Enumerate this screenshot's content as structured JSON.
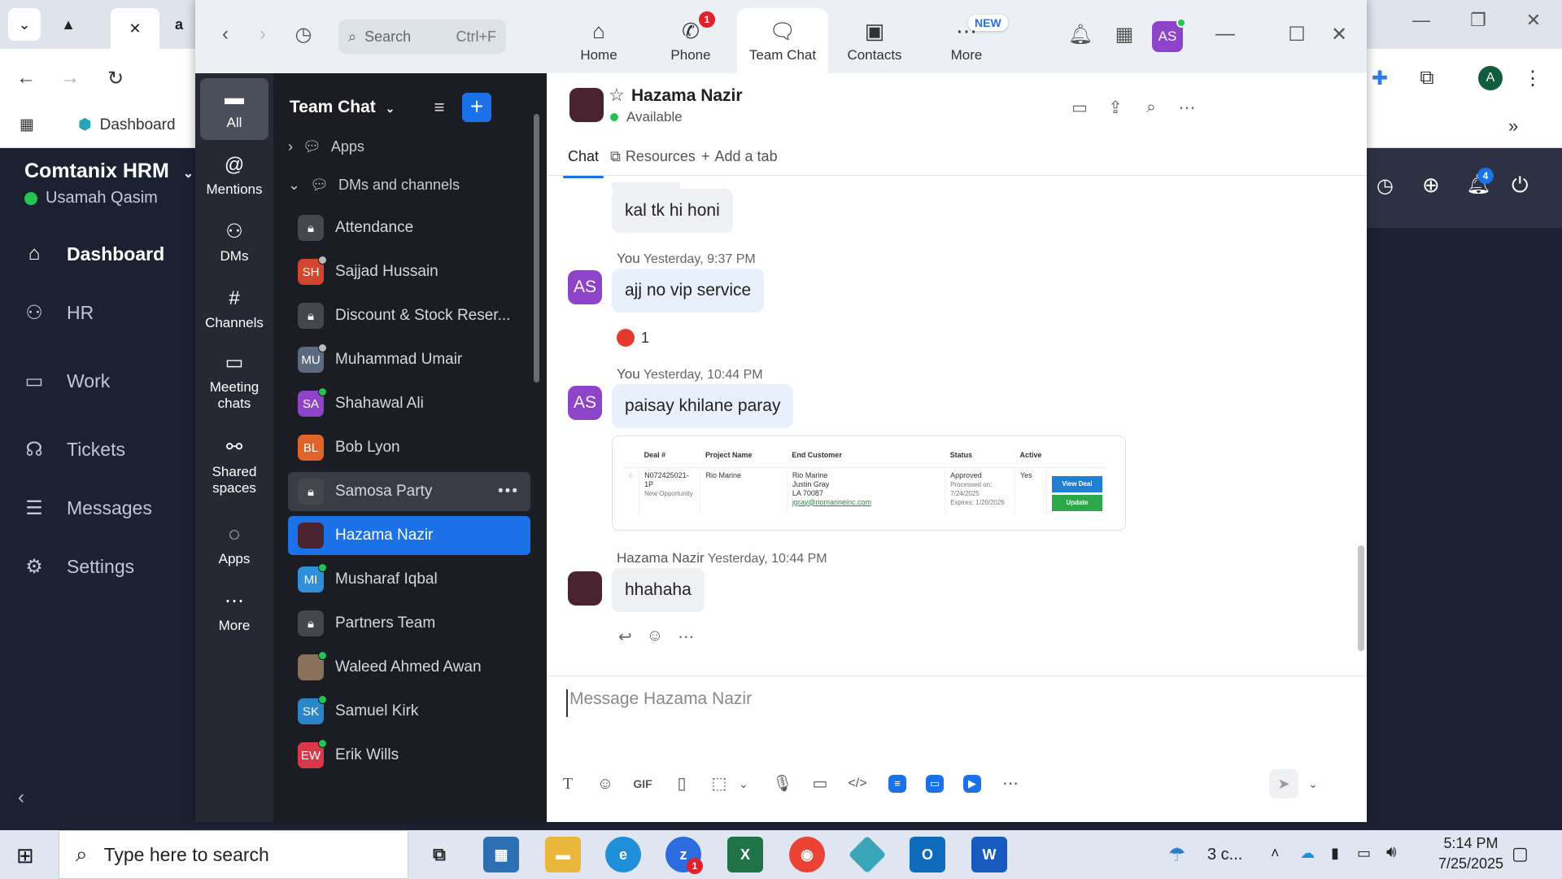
{
  "browser": {
    "bookmarks": [
      {
        "label": "Dashboard"
      }
    ]
  },
  "hrm": {
    "brand": "Comtanix HRM",
    "user": "Usamah Qasim",
    "nav": [
      {
        "label": "Dashboard",
        "icon": "home-icon"
      },
      {
        "label": "HR",
        "icon": "people-icon"
      },
      {
        "label": "Work",
        "icon": "briefcase-icon"
      },
      {
        "label": "Tickets",
        "icon": "headset-icon"
      },
      {
        "label": "Messages",
        "icon": "chat-icon"
      },
      {
        "label": "Settings",
        "icon": "gear-icon"
      }
    ],
    "notif_count": "4"
  },
  "zoom": {
    "search": {
      "label": "Search",
      "shortcut": "Ctrl+F"
    },
    "tabs": [
      {
        "label": "Home",
        "icon": "home-icon"
      },
      {
        "label": "Phone",
        "icon": "phone-icon",
        "badge": "1"
      },
      {
        "label": "Team Chat",
        "icon": "chat-icon",
        "active": true
      },
      {
        "label": "Contacts",
        "icon": "contacts-icon"
      },
      {
        "label": "More",
        "icon": "more-icon",
        "badge": "NEW"
      }
    ],
    "user_avatar": "AS",
    "rail": [
      {
        "label": "All"
      },
      {
        "label": "Mentions"
      },
      {
        "label": "DMs"
      },
      {
        "label": "Channels"
      },
      {
        "label": "Meeting chats"
      },
      {
        "label": "Shared spaces"
      },
      {
        "label": "Apps"
      },
      {
        "label": "More"
      }
    ],
    "list": {
      "title": "Team Chat",
      "apps_section": "Apps",
      "dms_section": "DMs and channels",
      "items": [
        {
          "name": "Attendance",
          "type": "lock"
        },
        {
          "name": "Sajjad Hussain",
          "initials": "SH",
          "color": "#d2452f",
          "status": "away"
        },
        {
          "name": "Discount & Stock Reser...",
          "type": "lock"
        },
        {
          "name": "Muhammad Umair",
          "initials": "MU",
          "color": "#5b6a7e",
          "status": "away"
        },
        {
          "name": "Shahawal Ali",
          "initials": "SA",
          "color": "#8e44c9",
          "status": "online"
        },
        {
          "name": "Bob Lyon",
          "initials": "BL",
          "color": "#e0632a",
          "status": ""
        },
        {
          "name": "Samosa Party",
          "type": "lock",
          "hover": true
        },
        {
          "name": "Hazama Nazir",
          "initials": "",
          "color": "#4a2330",
          "status": "",
          "selected": true
        },
        {
          "name": "Musharaf Iqbal",
          "initials": "MI",
          "color": "#2f8fd8",
          "status": "online"
        },
        {
          "name": "Partners Team",
          "type": "lock"
        },
        {
          "name": "Waleed Ahmed Awan",
          "initials": "",
          "color": "#8a6f5a",
          "status": "online"
        },
        {
          "name": "Samuel Kirk",
          "initials": "SK",
          "color": "#2a86c9",
          "status": "online"
        },
        {
          "name": "Erik Wills",
          "initials": "EW",
          "color": "#d8384a",
          "status": "online"
        }
      ]
    },
    "chat": {
      "contact": "Hazama Nazir",
      "status": "Available",
      "tabs": [
        "Chat",
        "Resources",
        "Add a tab"
      ],
      "messages": [
        {
          "text": "kal tk hi honi"
        },
        {
          "author": "You",
          "time": "Yesterday, 9:37 PM",
          "initials": "AS",
          "text": "ajj no vip service",
          "reaction": "1"
        },
        {
          "author": "You",
          "time": "Yesterday, 10:44 PM",
          "initials": "AS",
          "text": "paisay khilane paray"
        },
        {
          "author": "Hazama Nazir",
          "time": "Yesterday, 10:44 PM",
          "text": "hhahaha"
        }
      ],
      "deal": {
        "headers": [
          "Deal #",
          "Project Name",
          "End Customer",
          "Status",
          "Active"
        ],
        "deal_no": "N072425021-1P",
        "deal_sub": "New Opportunity",
        "project": "Rio Marine",
        "customer_lines": [
          "Rio Marine",
          "Justin Gray",
          "LA 70087"
        ],
        "customer_email": "jgray@riomarineinc.com",
        "status": "Approved",
        "processed": "Processed on: 7/24/2025",
        "expires": "Expires: 1/20/2026",
        "active": "Yes",
        "btn_view": "View Deal",
        "btn_update": "Update"
      },
      "composer_placeholder": "Message Hazama Nazir",
      "gif_label": "GIF"
    }
  },
  "taskbar": {
    "search_placeholder": "Type here to search",
    "weather": "3 c...",
    "time": "5:14 PM",
    "date": "7/25/2025",
    "zoom_badge": "1"
  }
}
